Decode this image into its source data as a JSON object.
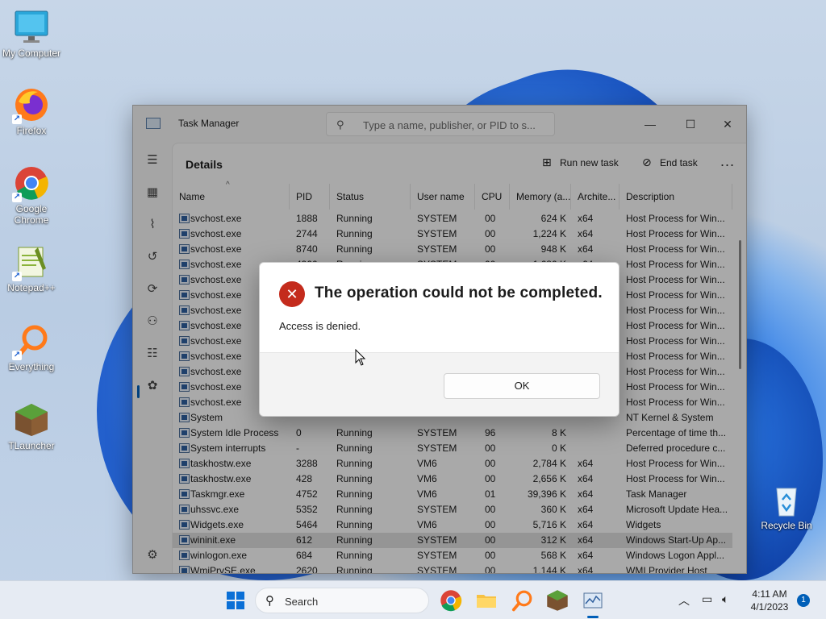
{
  "desktop": {
    "icons": [
      {
        "label": "My Computer",
        "icon": "monitor-icon"
      },
      {
        "label": "Firefox",
        "icon": "firefox-icon"
      },
      {
        "label": "Google Chrome",
        "icon": "chrome-icon"
      },
      {
        "label": "Notepad++",
        "icon": "notepadpp-icon"
      },
      {
        "label": "Everything",
        "icon": "everything-icon"
      },
      {
        "label": "TLauncher",
        "icon": "tlauncher-icon"
      },
      {
        "label": "Recycle Bin",
        "icon": "recycle-bin-icon"
      }
    ]
  },
  "task_manager": {
    "title": "Task Manager",
    "search_placeholder": "Type a name, publisher, or PID to s...",
    "page_title": "Details",
    "actions": {
      "run_new_task": "Run new task",
      "end_task": "End task",
      "more": "..."
    },
    "columns": [
      "Name",
      "PID",
      "Status",
      "User name",
      "CPU",
      "Memory (a...",
      "Archite...",
      "Description"
    ],
    "rows": [
      [
        "svchost.exe",
        "1888",
        "Running",
        "SYSTEM",
        "00",
        "624 K",
        "x64",
        "Host Process for Win..."
      ],
      [
        "svchost.exe",
        "2744",
        "Running",
        "SYSTEM",
        "00",
        "1,224 K",
        "x64",
        "Host Process for Win..."
      ],
      [
        "svchost.exe",
        "8740",
        "Running",
        "SYSTEM",
        "00",
        "948 K",
        "x64",
        "Host Process for Win..."
      ],
      [
        "svchost.exe",
        "4900",
        "Running",
        "SYSTEM",
        "00",
        "1,680 K",
        "x64",
        "Host Process for Win..."
      ],
      [
        "svchost.exe",
        "",
        "",
        "",
        "",
        "",
        "",
        "Host Process for Win..."
      ],
      [
        "svchost.exe",
        "",
        "",
        "",
        "",
        "",
        "",
        "Host Process for Win..."
      ],
      [
        "svchost.exe",
        "",
        "",
        "",
        "",
        "",
        "",
        "Host Process for Win..."
      ],
      [
        "svchost.exe",
        "",
        "",
        "",
        "",
        "",
        "",
        "Host Process for Win..."
      ],
      [
        "svchost.exe",
        "",
        "",
        "",
        "",
        "",
        "",
        "Host Process for Win..."
      ],
      [
        "svchost.exe",
        "",
        "",
        "",
        "",
        "",
        "",
        "Host Process for Win..."
      ],
      [
        "svchost.exe",
        "",
        "",
        "",
        "",
        "",
        "",
        "Host Process for Win..."
      ],
      [
        "svchost.exe",
        "",
        "",
        "",
        "",
        "",
        "",
        "Host Process for Win..."
      ],
      [
        "svchost.exe",
        "",
        "",
        "",
        "",
        "",
        "",
        "Host Process for Win..."
      ],
      [
        "System",
        "",
        "",
        "",
        "",
        "",
        "",
        "NT Kernel & System"
      ],
      [
        "System Idle Process",
        "0",
        "Running",
        "SYSTEM",
        "96",
        "8 K",
        "",
        "Percentage of time th..."
      ],
      [
        "System interrupts",
        "-",
        "Running",
        "SYSTEM",
        "00",
        "0 K",
        "",
        "Deferred procedure c..."
      ],
      [
        "taskhostw.exe",
        "3288",
        "Running",
        "VM6",
        "00",
        "2,784 K",
        "x64",
        "Host Process for Win..."
      ],
      [
        "taskhostw.exe",
        "428",
        "Running",
        "VM6",
        "00",
        "2,656 K",
        "x64",
        "Host Process for Win..."
      ],
      [
        "Taskmgr.exe",
        "4752",
        "Running",
        "VM6",
        "01",
        "39,396 K",
        "x64",
        "Task Manager"
      ],
      [
        "uhssvc.exe",
        "5352",
        "Running",
        "SYSTEM",
        "00",
        "360 K",
        "x64",
        "Microsoft Update Hea..."
      ],
      [
        "Widgets.exe",
        "5464",
        "Running",
        "VM6",
        "00",
        "5,716 K",
        "x64",
        "Widgets"
      ],
      [
        "wininit.exe",
        "612",
        "Running",
        "SYSTEM",
        "00",
        "312 K",
        "x64",
        "Windows Start-Up Ap..."
      ],
      [
        "winlogon.exe",
        "684",
        "Running",
        "SYSTEM",
        "00",
        "568 K",
        "x64",
        "Windows Logon Appl..."
      ],
      [
        "WmiPrvSE.exe",
        "2620",
        "Running",
        "SYSTEM",
        "00",
        "1,144 K",
        "x64",
        "WMI Provider Host"
      ]
    ],
    "selected_row": 21
  },
  "dialog": {
    "title": "The operation could not be completed.",
    "message": "Access is denied.",
    "ok_label": "OK"
  },
  "taskbar": {
    "search_label": "Search",
    "time": "4:11 AM",
    "date": "4/1/2023",
    "notifications": "1"
  }
}
